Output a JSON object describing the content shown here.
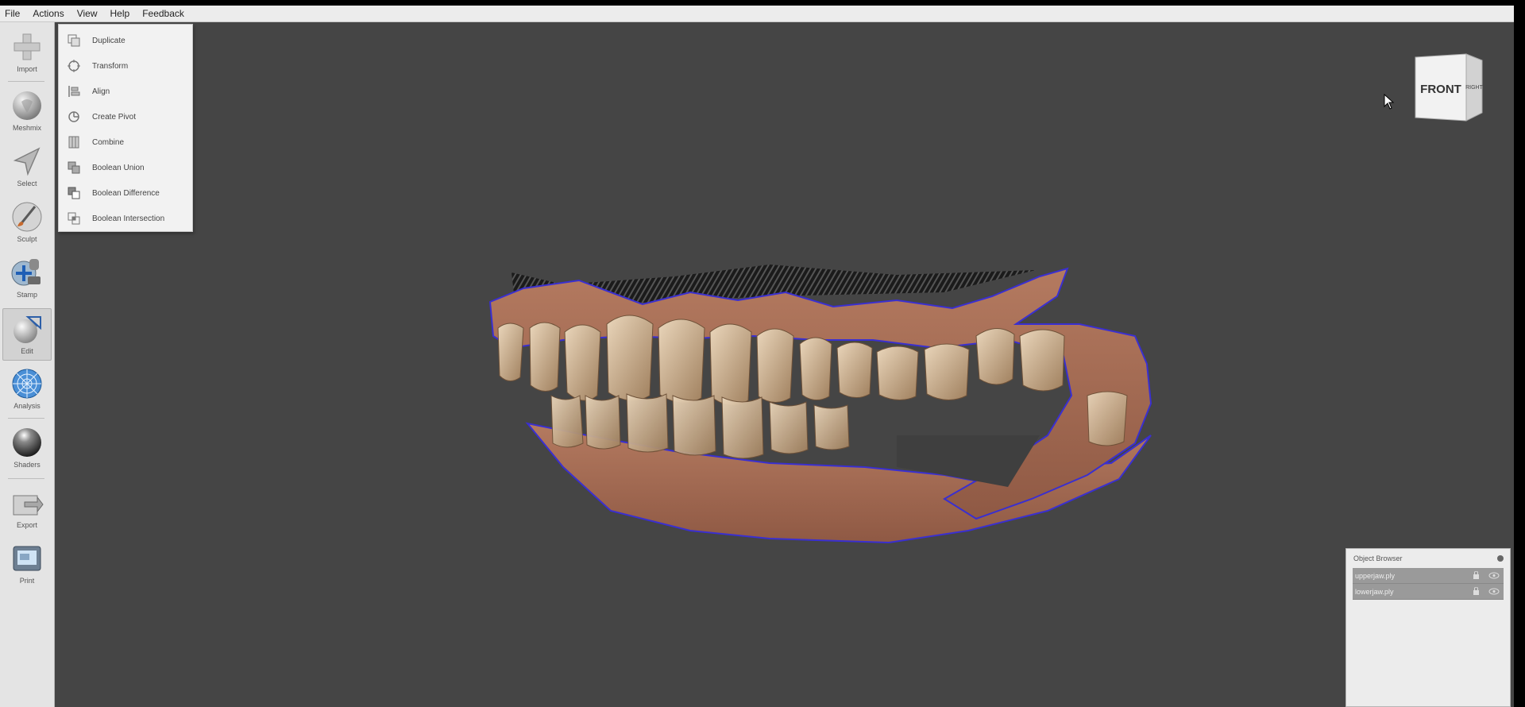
{
  "menubar": {
    "items": [
      "File",
      "Actions",
      "View",
      "Help",
      "Feedback"
    ]
  },
  "toolbar": {
    "tools": [
      {
        "label": "Import",
        "icon": "plus-icon"
      },
      {
        "label": "Meshmix",
        "icon": "meshmix-icon"
      },
      {
        "label": "Select",
        "icon": "select-arrow-icon"
      },
      {
        "label": "Sculpt",
        "icon": "brush-icon"
      },
      {
        "label": "Stamp",
        "icon": "stamp-icon"
      },
      {
        "label": "Edit",
        "icon": "edit-icon",
        "active": true
      },
      {
        "label": "Analysis",
        "icon": "analysis-icon"
      },
      {
        "label": "Shaders",
        "icon": "shaders-icon"
      },
      {
        "label": "Export",
        "icon": "export-icon"
      },
      {
        "label": "Print",
        "icon": "print-icon"
      }
    ]
  },
  "edit_menu": {
    "items": [
      {
        "label": "Duplicate",
        "icon": "duplicate-icon"
      },
      {
        "label": "Transform",
        "icon": "transform-icon"
      },
      {
        "label": "Align",
        "icon": "align-icon"
      },
      {
        "label": "Create Pivot",
        "icon": "pivot-icon"
      },
      {
        "label": "Combine",
        "icon": "combine-icon"
      },
      {
        "label": "Boolean Union",
        "icon": "boolean-union-icon"
      },
      {
        "label": "Boolean Difference",
        "icon": "boolean-difference-icon"
      },
      {
        "label": "Boolean Intersection",
        "icon": "boolean-intersection-icon"
      }
    ]
  },
  "nav_cube": {
    "front_label": "FRONT",
    "right_label": "RIGHT"
  },
  "object_browser": {
    "title": "Object Browser",
    "objects": [
      {
        "name": "upperjaw.ply"
      },
      {
        "name": "lowerjaw.ply"
      }
    ]
  },
  "colors": {
    "viewport_bg": "#454545",
    "selection_outline": "#3a2fd0",
    "gum": "#a5694f",
    "tooth": "#c9ad8c"
  }
}
